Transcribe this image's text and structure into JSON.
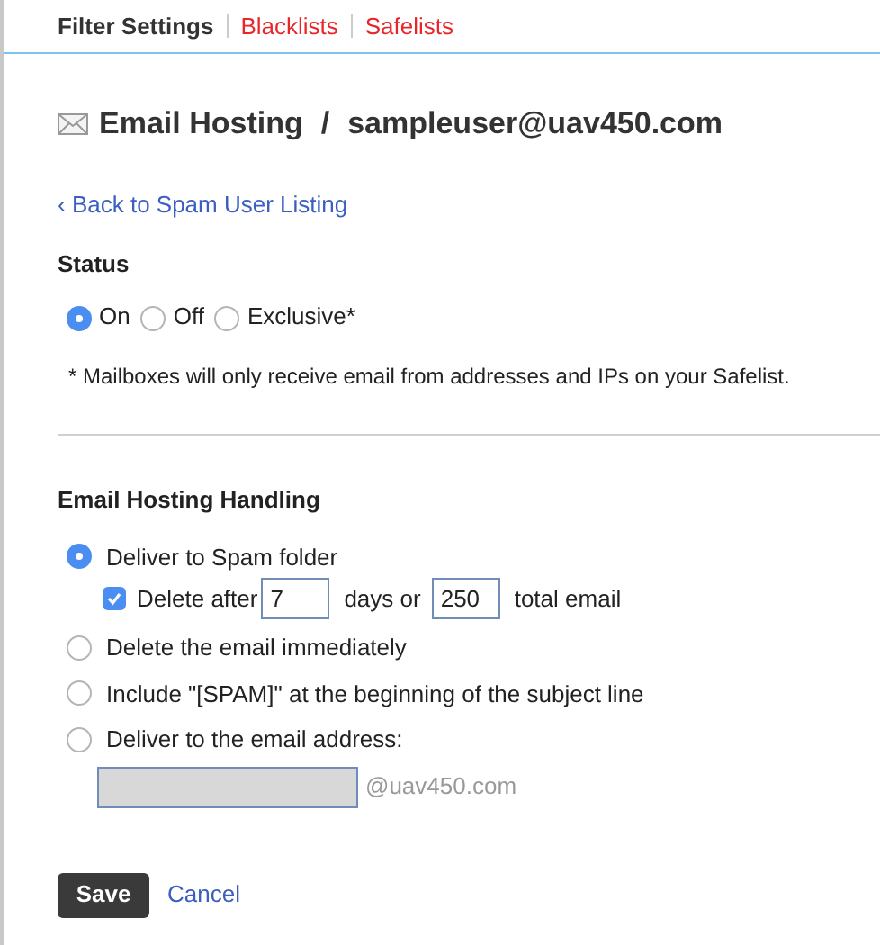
{
  "tabs": [
    {
      "label": "Filter Settings",
      "selected": true
    },
    {
      "label": "Blacklists",
      "selected": false
    },
    {
      "label": "Safelists",
      "selected": false
    }
  ],
  "title": {
    "service": "Email Hosting",
    "separator": "/",
    "account": "sampleuser@uav450.com"
  },
  "back_link": "‹ Back to Spam User Listing",
  "status": {
    "heading": "Status",
    "options": [
      {
        "label": "On",
        "selected": true
      },
      {
        "label": "Off",
        "selected": false
      },
      {
        "label": "Exclusive*",
        "selected": false
      }
    ],
    "note": "* Mailboxes will only receive email from addresses and IPs on your Safelist."
  },
  "handling": {
    "heading": "Email Hosting Handling",
    "options": [
      {
        "label": "Deliver to Spam folder",
        "selected": true,
        "delete_after": {
          "checked": true,
          "label": "Delete after",
          "days": "7",
          "middle": "days or",
          "total": "250",
          "suffix": "total email"
        }
      },
      {
        "label": "Delete the email immediately",
        "selected": false
      },
      {
        "label": "Include \"[SPAM]\" at the beginning of the subject line",
        "selected": false
      },
      {
        "label": "Deliver to the email address:",
        "selected": false,
        "address": {
          "disabled": true,
          "domain": "@uav450.com"
        }
      }
    ]
  },
  "buttons": {
    "save": "Save",
    "cancel": "Cancel"
  }
}
